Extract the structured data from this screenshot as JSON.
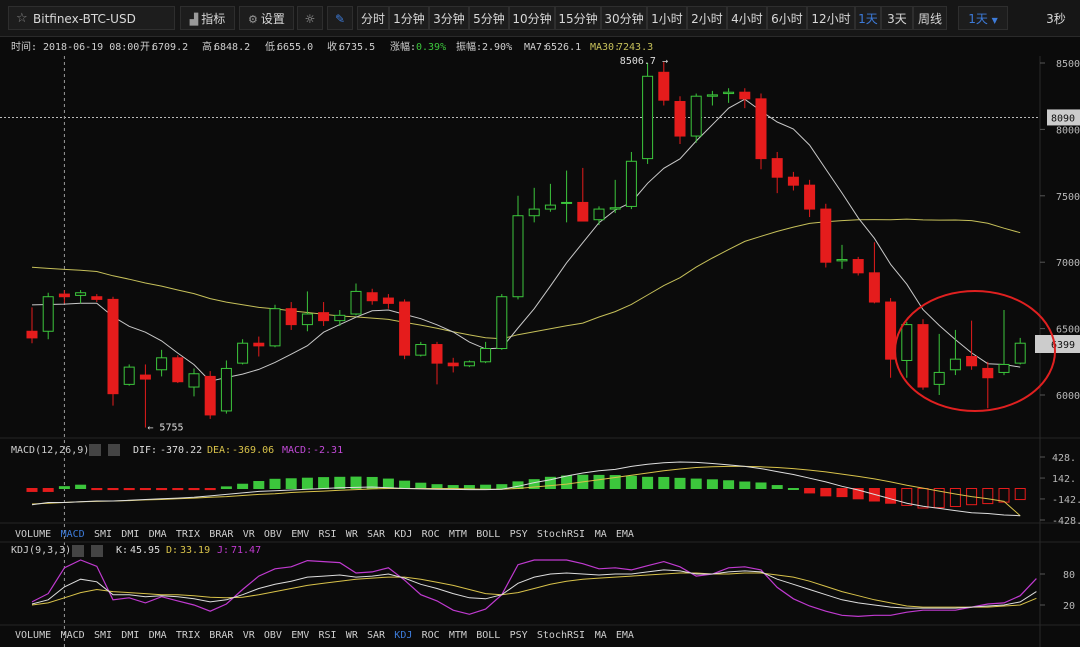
{
  "toolbar": {
    "symbol": "Bitfinex-BTC-USD",
    "indicators_label": "指标",
    "settings_label": "设置",
    "timeframes": [
      "分时",
      "1分钟",
      "3分钟",
      "5分钟",
      "10分钟",
      "15分钟",
      "30分钟",
      "1小时",
      "2小时",
      "4小时",
      "6小时",
      "12小时",
      "1天",
      "3天",
      "周线"
    ],
    "active_timeframe": "1天",
    "dropdown_value": "1天",
    "refresh_label": "3秒"
  },
  "colors": {
    "up": "#3cc63c",
    "down": "#e51c1c",
    "ma7": "#c9c9c9",
    "ma30": "#c6c05a",
    "accent": "#3d7bd9",
    "dif": "#dddddd",
    "dea": "#d8c24a",
    "macd": "#c24ad8",
    "k": "#dddddd",
    "d": "#d8c24a",
    "j": "#c03ad0",
    "circle": "#e02020"
  },
  "info": {
    "time_label": "时间:",
    "time": "2018-06-19 08:00",
    "open_label": "开:",
    "open": "6709.2",
    "high_label": "高:",
    "high": "6848.2",
    "low_label": "低:",
    "low": "6655.0",
    "close_label": "收:",
    "close": "6735.5",
    "change_label": "涨幅:",
    "change": "0.39%",
    "amp_label": "振幅:",
    "amp": "2.90%",
    "ma7_label": "MA7:",
    "ma7": "6526.1",
    "ma30_label": "MA30:",
    "ma30": "7243.3"
  },
  "chart_data": [
    {
      "type": "candlestick",
      "ylim": [
        5640,
        8560
      ],
      "y_ticks": [
        "8500",
        "8000",
        "7500",
        "7000",
        "6500",
        "6000"
      ],
      "price_tags": {
        "hline": "8090",
        "current": "6399"
      },
      "annotations": {
        "high": "8506.7",
        "low": "5755"
      },
      "candles": [
        {
          "o": 6480,
          "h": 6660,
          "l": 6390,
          "c": 6430
        },
        {
          "o": 6480,
          "h": 6770,
          "l": 6420,
          "c": 6740
        },
        {
          "o": 6760,
          "h": 6790,
          "l": 6690,
          "c": 6740
        },
        {
          "o": 6750,
          "h": 6790,
          "l": 6690,
          "c": 6770
        },
        {
          "o": 6740,
          "h": 6760,
          "l": 6700,
          "c": 6720
        },
        {
          "o": 6720,
          "h": 6740,
          "l": 5920,
          "c": 6010
        },
        {
          "o": 6080,
          "h": 6230,
          "l": 6070,
          "c": 6210
        },
        {
          "o": 6150,
          "h": 6230,
          "l": 5755,
          "c": 6120
        },
        {
          "o": 6190,
          "h": 6340,
          "l": 6140,
          "c": 6280
        },
        {
          "o": 6280,
          "h": 6300,
          "l": 6090,
          "c": 6100
        },
        {
          "o": 6060,
          "h": 6200,
          "l": 5990,
          "c": 6160
        },
        {
          "o": 6140,
          "h": 6180,
          "l": 5820,
          "c": 5850
        },
        {
          "o": 5880,
          "h": 6260,
          "l": 5860,
          "c": 6200
        },
        {
          "o": 6240,
          "h": 6420,
          "l": 6230,
          "c": 6390
        },
        {
          "o": 6390,
          "h": 6440,
          "l": 6290,
          "c": 6370
        },
        {
          "o": 6370,
          "h": 6680,
          "l": 6360,
          "c": 6650
        },
        {
          "o": 6650,
          "h": 6700,
          "l": 6490,
          "c": 6530
        },
        {
          "o": 6530,
          "h": 6780,
          "l": 6480,
          "c": 6610
        },
        {
          "o": 6620,
          "h": 6700,
          "l": 6520,
          "c": 6560
        },
        {
          "o": 6560,
          "h": 6640,
          "l": 6520,
          "c": 6600
        },
        {
          "o": 6610,
          "h": 6840,
          "l": 6600,
          "c": 6780
        },
        {
          "o": 6770,
          "h": 6800,
          "l": 6680,
          "c": 6710
        },
        {
          "o": 6730,
          "h": 6760,
          "l": 6650,
          "c": 6690
        },
        {
          "o": 6700,
          "h": 6720,
          "l": 6270,
          "c": 6300
        },
        {
          "o": 6300,
          "h": 6400,
          "l": 6290,
          "c": 6380
        },
        {
          "o": 6380,
          "h": 6400,
          "l": 6080,
          "c": 6240
        },
        {
          "o": 6240,
          "h": 6280,
          "l": 6170,
          "c": 6220
        },
        {
          "o": 6220,
          "h": 6260,
          "l": 6210,
          "c": 6250
        },
        {
          "o": 6250,
          "h": 6400,
          "l": 6240,
          "c": 6350
        },
        {
          "o": 6350,
          "h": 6760,
          "l": 6340,
          "c": 6740
        },
        {
          "o": 6740,
          "h": 7500,
          "l": 6720,
          "c": 7350
        },
        {
          "o": 7350,
          "h": 7560,
          "l": 7300,
          "c": 7400
        },
        {
          "o": 7400,
          "h": 7590,
          "l": 7380,
          "c": 7430
        },
        {
          "o": 7450,
          "h": 7690,
          "l": 7300,
          "c": 7450
        },
        {
          "o": 7450,
          "h": 7710,
          "l": 7310,
          "c": 7310
        },
        {
          "o": 7320,
          "h": 7420,
          "l": 7280,
          "c": 7400
        },
        {
          "o": 7400,
          "h": 7620,
          "l": 7370,
          "c": 7410
        },
        {
          "o": 7420,
          "h": 7830,
          "l": 7400,
          "c": 7760
        },
        {
          "o": 7780,
          "h": 8500,
          "l": 7740,
          "c": 8400
        },
        {
          "o": 8430,
          "h": 8507,
          "l": 8180,
          "c": 8220
        },
        {
          "o": 8210,
          "h": 8250,
          "l": 7890,
          "c": 7950
        },
        {
          "o": 7950,
          "h": 8270,
          "l": 7900,
          "c": 8250
        },
        {
          "o": 8250,
          "h": 8290,
          "l": 8180,
          "c": 8260
        },
        {
          "o": 8270,
          "h": 8310,
          "l": 8200,
          "c": 8280
        },
        {
          "o": 8280,
          "h": 8310,
          "l": 8160,
          "c": 8230
        },
        {
          "o": 8230,
          "h": 8270,
          "l": 7700,
          "c": 7780
        },
        {
          "o": 7780,
          "h": 7830,
          "l": 7520,
          "c": 7640
        },
        {
          "o": 7640,
          "h": 7680,
          "l": 7540,
          "c": 7580
        },
        {
          "o": 7580,
          "h": 7620,
          "l": 7340,
          "c": 7400
        },
        {
          "o": 7400,
          "h": 7440,
          "l": 6960,
          "c": 7000
        },
        {
          "o": 7010,
          "h": 7130,
          "l": 6950,
          "c": 7020
        },
        {
          "o": 7020,
          "h": 7040,
          "l": 6900,
          "c": 6920
        },
        {
          "o": 6920,
          "h": 7150,
          "l": 6690,
          "c": 6700
        },
        {
          "o": 6700,
          "h": 6730,
          "l": 6130,
          "c": 6270
        },
        {
          "o": 6260,
          "h": 6550,
          "l": 6130,
          "c": 6530
        },
        {
          "o": 6530,
          "h": 6570,
          "l": 6040,
          "c": 6060
        },
        {
          "o": 6080,
          "h": 6460,
          "l": 6000,
          "c": 6170
        },
        {
          "o": 6190,
          "h": 6490,
          "l": 6150,
          "c": 6270
        },
        {
          "o": 6290,
          "h": 6560,
          "l": 6190,
          "c": 6220
        },
        {
          "o": 6200,
          "h": 6250,
          "l": 5900,
          "c": 6130
        },
        {
          "o": 6170,
          "h": 6640,
          "l": 6150,
          "c": 6230
        },
        {
          "o": 6240,
          "h": 6430,
          "l": 6230,
          "c": 6390
        }
      ]
    },
    {
      "type": "bar",
      "indicator": "MACD",
      "label": "MACD(12,26,9)",
      "dif_label": "DIF:",
      "dif": "-370.22",
      "dea_label": "DEA:",
      "dea": "-369.06",
      "macd_label": "MACD:",
      "macd": "-2.31",
      "ylim": [
        -470,
        470
      ],
      "y_ticks": [
        "428.",
        "142.",
        "-142.",
        "-428."
      ],
      "hist": [
        -40,
        -40,
        25,
        45,
        -15,
        -15,
        -15,
        -15,
        -15,
        -15,
        -15,
        -15,
        22,
        58,
        95,
        125,
        132,
        140,
        148,
        152,
        155,
        150,
        128,
        100,
        72,
        52,
        40,
        40,
        45,
        52,
        90,
        120,
        152,
        170,
        180,
        178,
        176,
        166,
        152,
        150,
        138,
        128,
        118,
        105,
        88,
        75,
        40,
        0,
        -60,
        -100,
        -110,
        -140,
        -170,
        -200,
        -230,
        -265,
        -260,
        -245,
        -220,
        -205,
        -185,
        -150
      ],
      "dif_line": [
        -220,
        -190,
        -190,
        -180,
        -170,
        -170,
        -160,
        -150,
        -140,
        -130,
        -120,
        -100,
        -80,
        -60,
        -40,
        -30,
        -20,
        -10,
        0,
        10,
        15,
        20,
        10,
        0,
        -5,
        -10,
        -12,
        -15,
        -15,
        -10,
        30,
        80,
        120,
        170,
        210,
        240,
        260,
        300,
        330,
        350,
        360,
        355,
        340,
        320,
        300,
        270,
        230,
        190,
        140,
        90,
        30,
        -20,
        -80,
        -140,
        -200,
        -240,
        -270,
        -300,
        -330,
        -340,
        -360,
        -370
      ],
      "dea_line": [
        -210,
        -200,
        -190,
        -180,
        -175,
        -170,
        -165,
        -155,
        -150,
        -140,
        -130,
        -120,
        -110,
        -95,
        -80,
        -70,
        -55,
        -45,
        -35,
        -25,
        -15,
        -5,
        0,
        0,
        0,
        0,
        0,
        -5,
        -10,
        -10,
        0,
        20,
        40,
        60,
        90,
        120,
        150,
        180,
        210,
        240,
        265,
        285,
        295,
        300,
        300,
        295,
        285,
        270,
        250,
        225,
        195,
        165,
        130,
        90,
        45,
        5,
        -35,
        -75,
        -110,
        -140,
        -175,
        -369
      ]
    },
    {
      "type": "line",
      "indicator": "KDJ",
      "label": "KDJ(9,3,3)",
      "k_label": "K:",
      "k": "45.95",
      "d_label": "D:",
      "d": "33.19",
      "j_label": "J:",
      "j": "71.47",
      "ylim": [
        0,
        110
      ],
      "y_ticks": [
        "80",
        "20"
      ],
      "k_line": [
        22,
        30,
        55,
        70,
        65,
        40,
        40,
        36,
        38,
        36,
        32,
        26,
        30,
        40,
        52,
        60,
        66,
        74,
        76,
        78,
        74,
        76,
        80,
        72,
        60,
        52,
        42,
        34,
        32,
        40,
        62,
        74,
        80,
        82,
        80,
        78,
        80,
        80,
        84,
        88,
        86,
        80,
        80,
        84,
        86,
        84,
        70,
        60,
        50,
        40,
        30,
        24,
        20,
        16,
        14,
        14,
        14,
        14,
        16,
        18,
        20,
        26,
        46
      ],
      "d_line": [
        20,
        24,
        34,
        44,
        50,
        46,
        44,
        42,
        40,
        40,
        38,
        35,
        34,
        35,
        40,
        46,
        52,
        58,
        62,
        66,
        70,
        72,
        74,
        74,
        70,
        64,
        58,
        50,
        42,
        40,
        44,
        52,
        60,
        66,
        70,
        72,
        74,
        76,
        78,
        80,
        82,
        82,
        80,
        80,
        82,
        82,
        78,
        74,
        66,
        56,
        46,
        38,
        30,
        24,
        18,
        16,
        16,
        16,
        16,
        16,
        18,
        20,
        33
      ],
      "j_line": [
        26,
        42,
        92,
        108,
        95,
        30,
        34,
        24,
        36,
        28,
        20,
        8,
        22,
        50,
        76,
        90,
        94,
        106,
        104,
        102,
        82,
        84,
        92,
        68,
        40,
        28,
        10,
        2,
        12,
        40,
        98,
        118,
        120,
        114,
        100,
        90,
        92,
        88,
        96,
        104,
        94,
        76,
        80,
        92,
        94,
        88,
        54,
        32,
        18,
        8,
        0,
        -2,
        0,
        0,
        6,
        10,
        10,
        10,
        16,
        22,
        24,
        38,
        71
      ]
    }
  ],
  "tabs_row1": [
    "VOLUME",
    "MACD",
    "SMI",
    "DMI",
    "DMA",
    "TRIX",
    "BRAR",
    "VR",
    "OBV",
    "EMV",
    "RSI",
    "WR",
    "SAR",
    "KDJ",
    "ROC",
    "MTM",
    "BOLL",
    "PSY",
    "StochRSI",
    "MA",
    "EMA"
  ],
  "tabs_row1_active": "MACD",
  "tabs_row2": [
    "VOLUME",
    "MACD",
    "SMI",
    "DMI",
    "DMA",
    "TRIX",
    "BRAR",
    "VR",
    "OBV",
    "EMV",
    "RSI",
    "WR",
    "SAR",
    "KDJ",
    "ROC",
    "MTM",
    "BOLL",
    "PSY",
    "StochRSI",
    "MA",
    "EMA"
  ],
  "tabs_row2_active": "KDJ"
}
